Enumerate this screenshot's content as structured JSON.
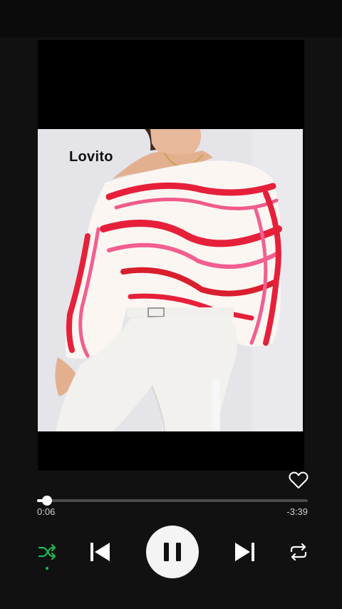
{
  "player": {
    "artwork": {
      "brand_text": "Lovito",
      "alt_icon": "blouse-photo"
    },
    "elapsed": "0:06",
    "remaining": "-3:39",
    "progress_fraction": 0.037,
    "liked": false,
    "is_playing": true,
    "shuffle_on": true,
    "accent_color": "#1db954",
    "icons": {
      "favorite": "heart-outline-icon",
      "shuffle": "shuffle-icon",
      "previous": "skip-previous-icon",
      "play_pause": "pause-icon",
      "next": "skip-next-icon",
      "repeat": "repeat-icon"
    }
  }
}
